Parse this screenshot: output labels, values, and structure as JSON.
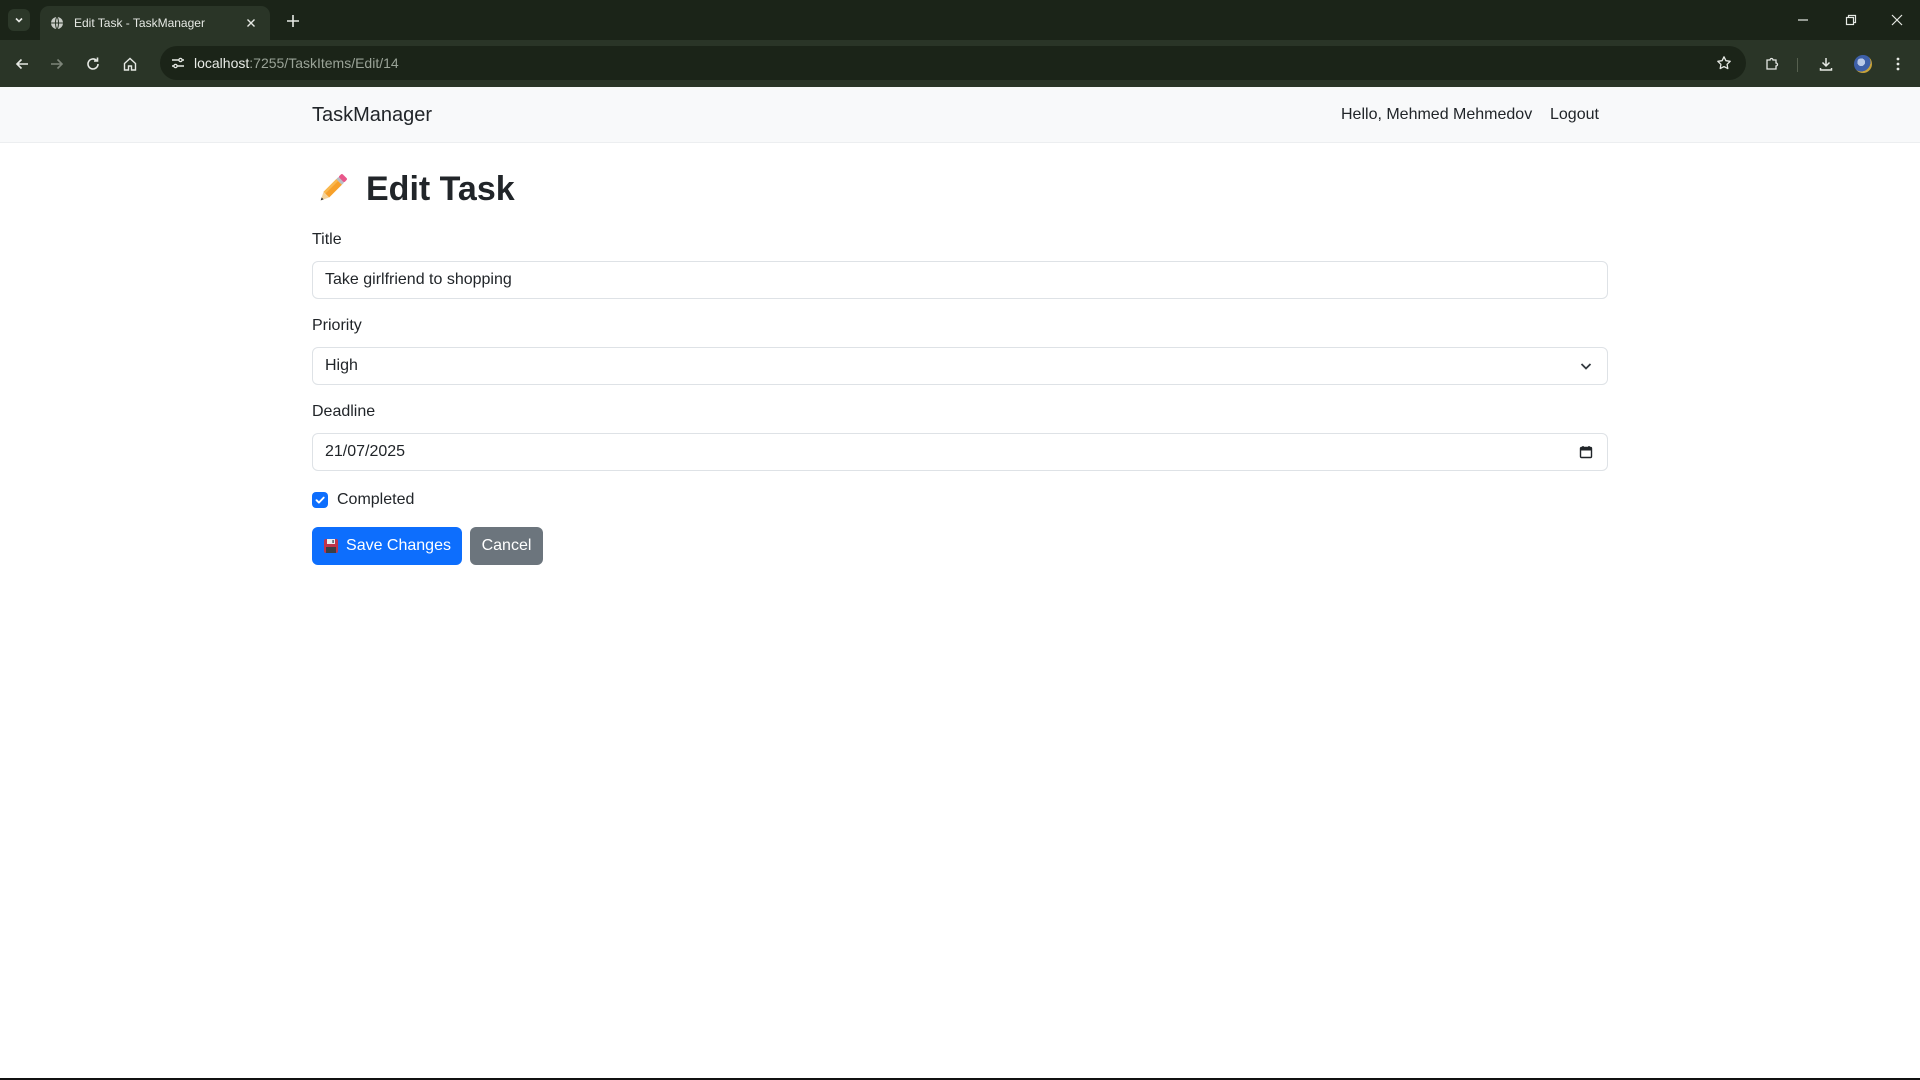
{
  "browser": {
    "tab_title": "Edit Task - TaskManager",
    "url_host": "localhost",
    "url_path": ":7255/TaskItems/Edit/14"
  },
  "navbar": {
    "brand": "TaskManager",
    "greeting": "Hello, Mehmed Mehmedov",
    "logout": "Logout"
  },
  "page": {
    "title": "Edit Task",
    "title_icon": "pencil-icon"
  },
  "form": {
    "title_label": "Title",
    "title_value": "Take girlfriend to shopping",
    "priority_label": "Priority",
    "priority_value": "High",
    "deadline_label": "Deadline",
    "deadline_value": "21/07/2025",
    "completed_label": "Completed",
    "completed_checked": true,
    "save_label": "Save Changes",
    "save_icon": "floppy-disk-icon",
    "cancel_label": "Cancel"
  },
  "colors": {
    "primary": "#0d6efd",
    "secondary": "#6c757d",
    "navbar_bg": "#f8f9fa",
    "chrome_dark": "#1b2418",
    "chrome_toolbar": "#2a3527"
  }
}
